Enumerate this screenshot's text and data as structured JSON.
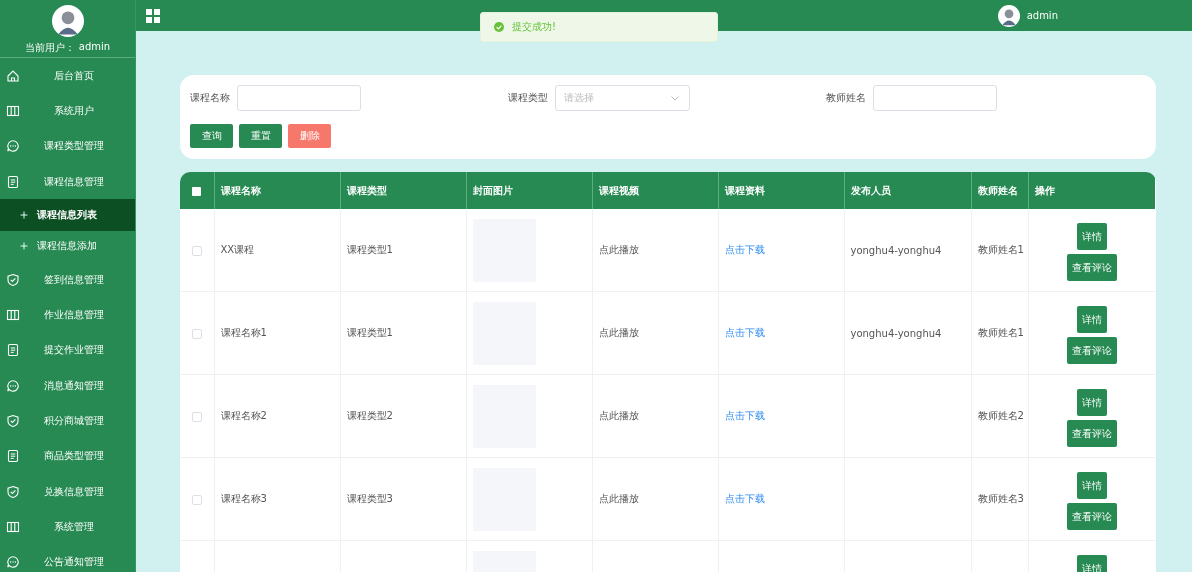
{
  "sidebar": {
    "user_label": "当前用户：",
    "user_name": "admin",
    "items": [
      {
        "label": "后台首页",
        "kind": "home"
      },
      {
        "label": "系统用户",
        "kind": "columns"
      },
      {
        "label": "课程类型管理",
        "kind": "chat"
      },
      {
        "label": "课程信息管理",
        "kind": "doc",
        "children": [
          {
            "label": "课程信息列表",
            "selected": true
          },
          {
            "label": "课程信息添加",
            "selected": false
          }
        ]
      },
      {
        "label": "签到信息管理",
        "kind": "shield"
      },
      {
        "label": "作业信息管理",
        "kind": "columns"
      },
      {
        "label": "提交作业管理",
        "kind": "doc"
      },
      {
        "label": "消息通知管理",
        "kind": "chat"
      },
      {
        "label": "积分商城管理",
        "kind": "shield"
      },
      {
        "label": "商品类型管理",
        "kind": "doc"
      },
      {
        "label": "兑换信息管理",
        "kind": "shield"
      },
      {
        "label": "系统管理",
        "kind": "columns"
      },
      {
        "label": "公告通知管理",
        "kind": "chat"
      }
    ]
  },
  "header": {
    "user_name": "admin"
  },
  "toast": {
    "kind": "success",
    "message": "提交成功!"
  },
  "search": {
    "fields": [
      {
        "label": "课程名称",
        "kind": "input"
      },
      {
        "label": "课程类型",
        "kind": "select",
        "placeholder": "请选择"
      },
      {
        "label": "教师姓名",
        "kind": "input"
      }
    ],
    "buttons": [
      {
        "label": "查询",
        "kind": "primary"
      },
      {
        "label": "重置",
        "kind": "primary"
      },
      {
        "label": "删除",
        "kind": "danger"
      }
    ]
  },
  "table": {
    "all_checked": false,
    "columns": [
      "课程名称",
      "课程类型",
      "封面图片",
      "课程视频",
      "课程资料",
      "发布人员",
      "教师姓名",
      "操作"
    ],
    "rows": [
      {
        "selected": false,
        "name": "XX课程",
        "type": "课程类型1",
        "video": "点此播放",
        "material": "点击下载",
        "publisher": "yonghu4-yonghu4",
        "teacher": "教师姓名1",
        "actions": [
          "详情",
          "查看评论"
        ]
      },
      {
        "selected": false,
        "name": "课程名称1",
        "type": "课程类型1",
        "video": "点此播放",
        "material": "点击下载",
        "publisher": "yonghu4-yonghu4",
        "teacher": "教师姓名1",
        "actions": [
          "详情",
          "查看评论"
        ]
      },
      {
        "selected": false,
        "name": "课程名称2",
        "type": "课程类型2",
        "video": "点此播放",
        "material": "点击下载",
        "teacher": "教师姓名2",
        "actions": [
          "详情",
          "查看评论"
        ]
      },
      {
        "selected": false,
        "name": "课程名称3",
        "type": "课程类型3",
        "video": "点此播放",
        "material": "点击下载",
        "teacher": "教师姓名3",
        "actions": [
          "详情",
          "查看评论"
        ]
      },
      {
        "actions": [
          "详情"
        ]
      }
    ]
  }
}
